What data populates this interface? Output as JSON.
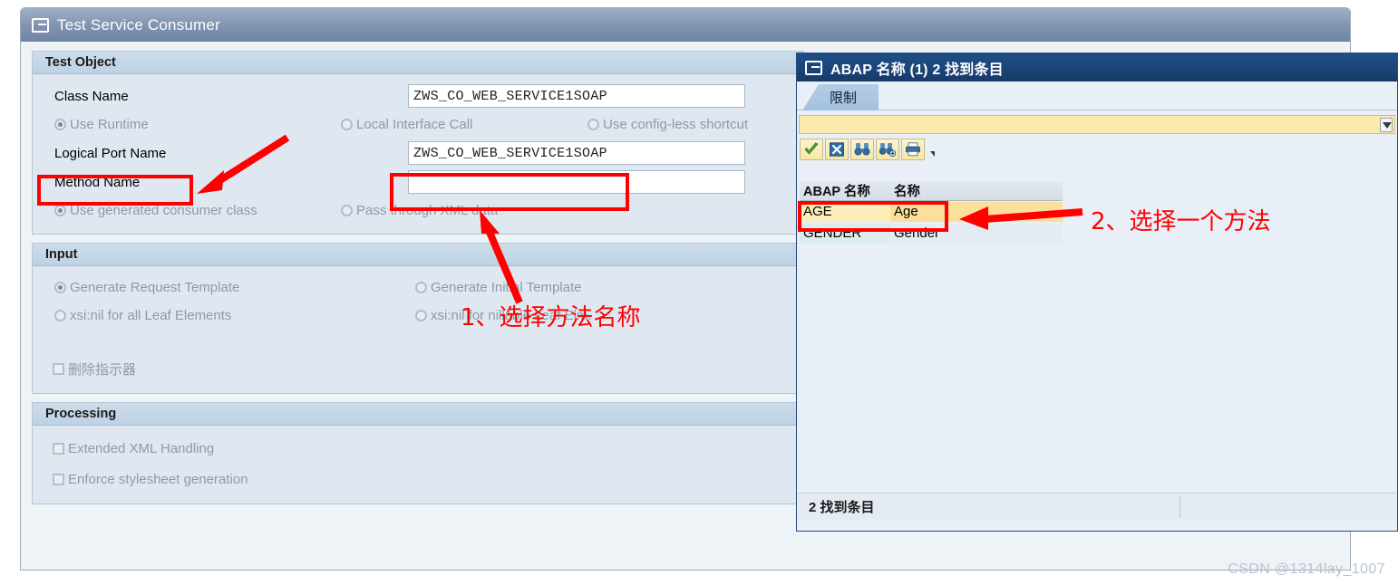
{
  "main_window": {
    "title": "Test Service Consumer",
    "title_icon": "window-sap-icon",
    "sections": {
      "test_object": {
        "header": "Test Object",
        "fields": [
          {
            "label": "Class Name",
            "value": "ZWS_CO_WEB_SERVICE1SOAP"
          },
          {
            "label": "Logical Port Name",
            "value": "ZWS_CO_WEB_SERVICE1SOAP"
          },
          {
            "label": "Method Name",
            "value": ""
          }
        ],
        "radio_row_1": [
          {
            "label": "Use Runtime",
            "selected": true
          },
          {
            "label": "Local Interface Call",
            "selected": false
          },
          {
            "label": "Use config-less shortcut",
            "selected": false
          }
        ],
        "radio_row_2": [
          {
            "label": "Use generated consumer class",
            "selected": true
          },
          {
            "label": "Pass through XML data",
            "selected": false
          }
        ]
      },
      "input": {
        "header": "Input",
        "radios": [
          {
            "label": "Generate Request Template",
            "selected": true
          },
          {
            "label": "Generate Initial Template",
            "selected": false
          },
          {
            "label": "xsi:nil for all Leaf Elements",
            "selected": false
          },
          {
            "label": "xsi:nil for nillable Leaf Elm.",
            "selected": false
          }
        ],
        "checkboxes": [
          {
            "label": "删除指示器",
            "checked": false
          }
        ]
      },
      "processing": {
        "header": "Processing",
        "checkboxes": [
          {
            "label": "Extended XML Handling",
            "checked": false
          },
          {
            "label": "Enforce stylesheet generation",
            "checked": false
          }
        ]
      }
    }
  },
  "abap_dialog": {
    "title": "ABAP 名称 (1)    2 找到条目",
    "title_icon": "window-sap-icon",
    "tab": "限制",
    "search_value": "",
    "toolbar": [
      {
        "name": "confirm-check-icon",
        "glyph": "✔"
      },
      {
        "name": "cancel-x-icon",
        "glyph": "✖"
      },
      {
        "name": "find-binoculars-icon",
        "glyph": "⑃"
      },
      {
        "name": "find-next-binoculars-icon",
        "glyph": "⑃"
      },
      {
        "name": "print-icon",
        "glyph": "🖶"
      }
    ],
    "table": {
      "columns": [
        "ABAP 名称",
        "名称"
      ],
      "rows": [
        {
          "abap_name": "AGE",
          "name": "Age",
          "selected": true
        },
        {
          "abap_name": "GENDER",
          "name": "Gender",
          "selected": false
        }
      ]
    },
    "status": "2 找到条目"
  },
  "annotations": [
    {
      "id": "anno-1",
      "text": "1、选择方法名称"
    },
    {
      "id": "anno-2",
      "text": "2、选择一个方法"
    }
  ],
  "watermark": "CSDN @1314lay_1007",
  "colors": {
    "annotation_red": "#ff0000",
    "dialog_title_blue": "#1b4478",
    "main_title_blue_gray": "#8294b0",
    "selected_row_yellow": "#fceeb8"
  }
}
